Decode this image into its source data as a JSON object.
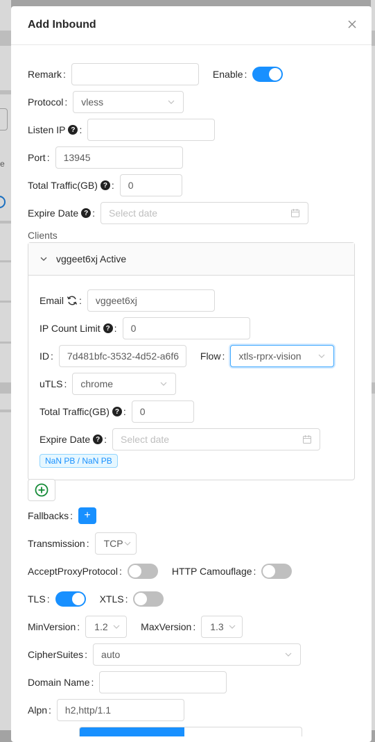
{
  "modal": {
    "title": "Add Inbound"
  },
  "form": {
    "remark": {
      "label": "Remark",
      "value": ""
    },
    "enable": {
      "label": "Enable",
      "checked": true
    },
    "protocol": {
      "label": "Protocol",
      "value": "vless"
    },
    "listen_ip": {
      "label": "Listen IP",
      "value": ""
    },
    "port": {
      "label": "Port",
      "value": "13945"
    },
    "total_traffic": {
      "label": "Total Traffic(GB)",
      "value": "0"
    },
    "expire_date": {
      "label": "Expire Date",
      "placeholder": "Select date"
    },
    "clients_label": "Clients"
  },
  "client": {
    "header": "vggeet6xj Active",
    "email": {
      "label": "Email",
      "value": "vggeet6xj"
    },
    "ip_limit": {
      "label": "IP Count Limit",
      "value": "0"
    },
    "id": {
      "label": "ID",
      "value": "7d481bfc-3532-4d52-a6f6"
    },
    "flow": {
      "label": "Flow",
      "value": "xtls-rprx-vision"
    },
    "utls": {
      "label": "uTLS",
      "value": "chrome"
    },
    "total_traffic": {
      "label": "Total Traffic(GB)",
      "value": "0"
    },
    "expire_date": {
      "label": "Expire Date",
      "placeholder": "Select date"
    },
    "usage_tag": "NaN PB / NaN PB"
  },
  "fallbacks": {
    "label": "Fallbacks",
    "add": "+"
  },
  "transmission": {
    "label": "Transmission",
    "value": "TCP"
  },
  "accept_proxy": {
    "label": "AcceptProxyProtocol",
    "checked": false
  },
  "http_camouflage": {
    "label": "HTTP Camouflage",
    "checked": false
  },
  "tls": {
    "label": "TLS",
    "checked": true
  },
  "xtls": {
    "label": "XTLS",
    "checked": false
  },
  "min_version": {
    "label": "MinVersion",
    "value": "1.2"
  },
  "max_version": {
    "label": "MaxVersion",
    "value": "1.3"
  },
  "cipher_suites": {
    "label": "CipherSuites",
    "value": "auto"
  },
  "domain_name": {
    "label": "Domain Name",
    "value": ""
  },
  "alpn": {
    "label": "Alpn",
    "value": "h2,http/1.1"
  },
  "icons": {
    "close": "close-icon",
    "chevron": "chevron-down-icon",
    "calendar": "calendar-icon",
    "help": "question-circle-icon",
    "sync": "sync-icon",
    "add": "plus-circle-icon"
  },
  "colors": {
    "primary": "#1890ff",
    "add_icon": "#138a36"
  }
}
